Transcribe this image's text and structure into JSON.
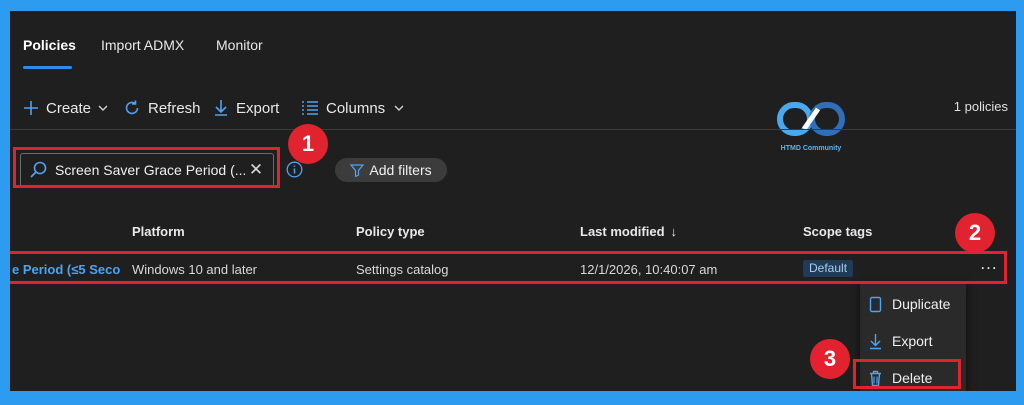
{
  "tabs": [
    {
      "label": "Policies",
      "active": true
    },
    {
      "label": "Import ADMX",
      "active": false
    },
    {
      "label": "Monitor",
      "active": false
    }
  ],
  "toolbar": {
    "create_label": "Create",
    "refresh_label": "Refresh",
    "export_label": "Export",
    "columns_label": "Columns",
    "count_label": "1 policies"
  },
  "watermark": {
    "text": "HTMD Community"
  },
  "search": {
    "value": "Screen Saver Grace Period (..."
  },
  "filters": {
    "add_label": "Add filters"
  },
  "table": {
    "headers": [
      "Platform",
      "Policy type",
      "Last modified",
      "Scope tags"
    ],
    "sort_indicator": "↓",
    "rows": [
      {
        "name": "e Period (≤5 Seco",
        "platform": "Windows 10 and later",
        "policy_type": "Settings catalog",
        "last_modified": "12/1/2026, 10:40:07 am",
        "scope_tag": "Default"
      }
    ]
  },
  "row_actions": {
    "more_label": "..."
  },
  "context_menu": {
    "items": [
      {
        "label": "Duplicate",
        "icon": "duplicate-icon"
      },
      {
        "label": "Export",
        "icon": "download-icon"
      },
      {
        "label": "Delete",
        "icon": "trash-icon"
      }
    ]
  },
  "callouts": [
    "1",
    "2",
    "3"
  ],
  "colors": {
    "accent": "#2f8be6",
    "highlight": "#e0232e",
    "border": "#2d9cf0",
    "background": "#1f1f1f"
  }
}
